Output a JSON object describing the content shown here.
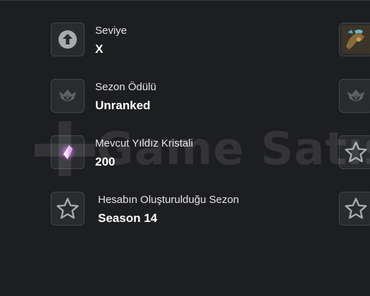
{
  "stats": [
    {
      "label": "Seviye",
      "value": "X",
      "icon": "arrow-up-circle-icon"
    },
    {
      "label": "Sezon Ödülü",
      "value": "Unranked",
      "icon": "unranked-emblem-icon"
    },
    {
      "label": "Mevcut Yıldız Kristali",
      "value": "200",
      "icon": "star-crystal-icon"
    },
    {
      "label": "Hesabın Oluşturulduğu Sezon",
      "value": "Season 14",
      "icon": "star-outline-icon"
    }
  ],
  "right_icons": [
    "champion-portrait-icon",
    "unranked-emblem-icon",
    "star-outline-icon",
    "star-outline-icon"
  ],
  "watermark": {
    "text": "Game Satış"
  },
  "colors": {
    "background": "#1d1e20",
    "icon_box": "#2a2b2e",
    "border": "#45464a",
    "icon_grey": "#a9aaad"
  }
}
